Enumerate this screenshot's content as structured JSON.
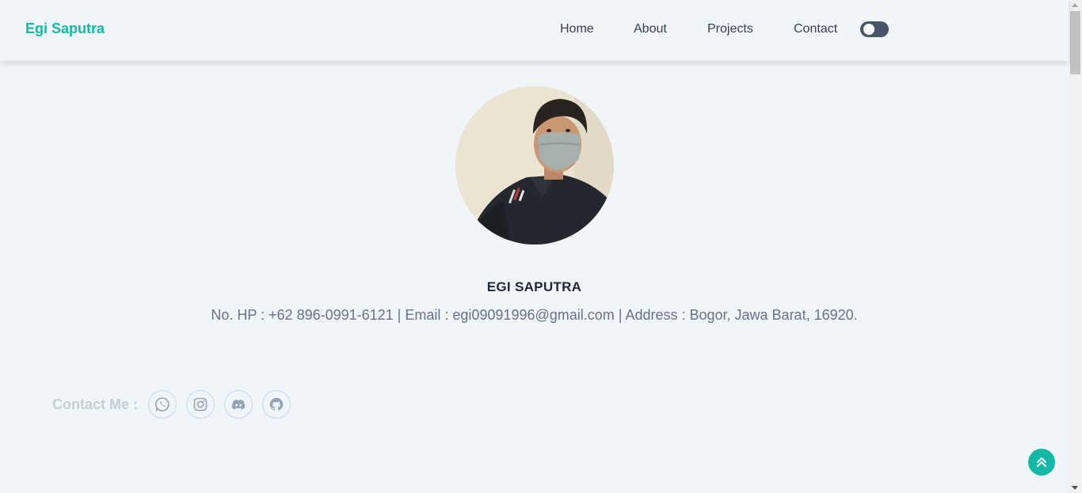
{
  "navbar": {
    "brand": "Egi Saputra",
    "links": [
      "Home",
      "About",
      "Projects",
      "Contact"
    ],
    "theme_toggle": "dark-mode-toggle"
  },
  "profile": {
    "name": "EGI SAPUTRA",
    "info": "No. HP : +62 896-0991-6121 | Email : egi09091996@gmail.com | Address : Bogor, Jawa Barat, 16920."
  },
  "contact": {
    "label": "Contact Me :",
    "icons": [
      "whatsapp-icon",
      "instagram-icon",
      "discord-icon",
      "github-icon"
    ]
  },
  "colors": {
    "accent": "#14b8a6",
    "background": "#f0f5f9",
    "text_dark": "#1e293b",
    "text_muted": "#64748b"
  }
}
